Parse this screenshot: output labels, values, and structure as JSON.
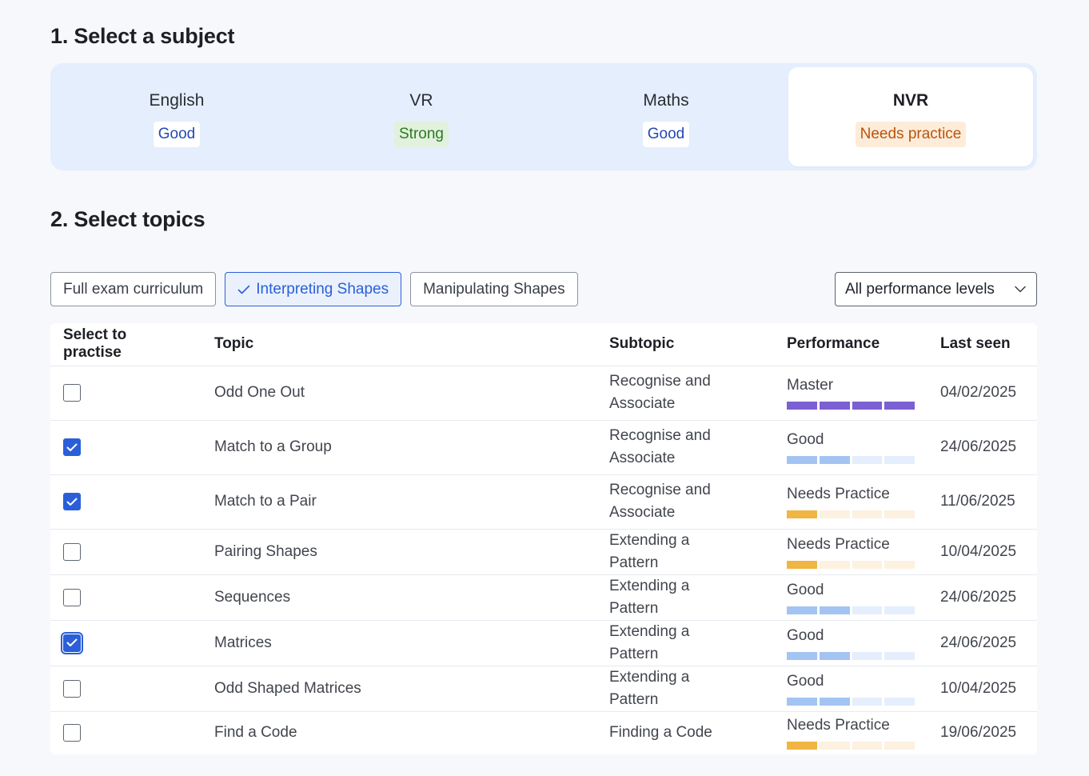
{
  "step1": {
    "title": "1. Select a subject"
  },
  "step2": {
    "title": "2. Select topics"
  },
  "subjects": [
    {
      "name": "English",
      "status": "Good",
      "status_type": "good",
      "active": false
    },
    {
      "name": "VR",
      "status": "Strong",
      "status_type": "strong",
      "active": false
    },
    {
      "name": "Maths",
      "status": "Good",
      "status_type": "good",
      "active": false
    },
    {
      "name": "NVR",
      "status": "Needs practice",
      "status_type": "needs",
      "active": true
    }
  ],
  "filters": {
    "chips": [
      {
        "label": "Full exam curriculum",
        "selected": false
      },
      {
        "label": "Interpreting Shapes",
        "selected": true
      },
      {
        "label": "Manipulating Shapes",
        "selected": false
      }
    ],
    "performance_dropdown": {
      "selected": "All performance levels"
    }
  },
  "table": {
    "headers": {
      "select": "Select to practise",
      "topic": "Topic",
      "subtopic": "Subtopic",
      "performance": "Performance",
      "last_seen": "Last seen"
    },
    "rows": [
      {
        "checked": false,
        "topic": "Odd One Out",
        "subtopic": "Recognise and Associate",
        "performance": "Master",
        "level": 4,
        "last_seen": "04/02/2025"
      },
      {
        "checked": true,
        "topic": "Match to a Group",
        "subtopic": "Recognise and Associate",
        "performance": "Good",
        "level": 2,
        "last_seen": "24/06/2025"
      },
      {
        "checked": true,
        "topic": "Match to a Pair",
        "subtopic": "Recognise and Associate",
        "performance": "Needs Practice",
        "level": 1,
        "last_seen": "11/06/2025"
      },
      {
        "checked": false,
        "topic": "Pairing Shapes",
        "subtopic": "Extending a Pattern",
        "performance": "Needs Practice",
        "level": 1,
        "last_seen": "10/04/2025"
      },
      {
        "checked": false,
        "topic": "Sequences",
        "subtopic": "Extending a Pattern",
        "performance": "Good",
        "level": 2,
        "last_seen": "24/06/2025"
      },
      {
        "checked": true,
        "topic": "Matrices",
        "subtopic": "Extending a Pattern",
        "performance": "Good",
        "level": 2,
        "last_seen": "24/06/2025",
        "focused": true
      },
      {
        "checked": false,
        "topic": "Odd Shaped Matrices",
        "subtopic": "Extending a Pattern",
        "performance": "Good",
        "level": 2,
        "last_seen": "10/04/2025"
      },
      {
        "checked": false,
        "topic": "Find a Code",
        "subtopic": "Finding a Code",
        "performance": "Needs Practice",
        "level": 1,
        "last_seen": "19/06/2025"
      }
    ]
  },
  "colors": {
    "accent": "#2b5fd9",
    "master_fill": "#7c5fd3",
    "good_fill": "#a3c4f3",
    "good_empty": "#e4eefc",
    "needs_fill": "#f0b542",
    "needs_empty": "#fdf1e0"
  },
  "icons": {
    "chip_selected": "check-icon",
    "dropdown": "chevron-down-icon",
    "checkbox_checked": "checkmark-icon"
  }
}
